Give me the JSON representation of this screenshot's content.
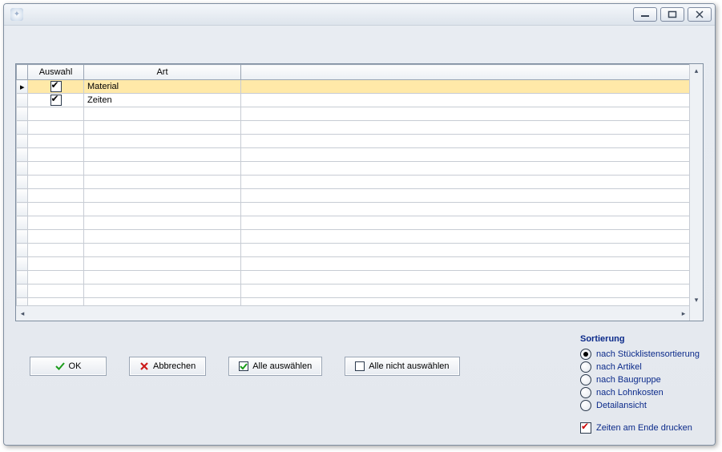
{
  "titlebar": {},
  "grid": {
    "columns": {
      "indicator": "",
      "auswahl": "Auswahl",
      "art": "Art"
    },
    "rows": [
      {
        "checked": true,
        "art": "Material",
        "selected": true,
        "current": true
      },
      {
        "checked": true,
        "art": "Zeiten",
        "selected": false,
        "current": false
      }
    ],
    "visible_empty_rows": 15
  },
  "buttons": {
    "ok": "OK",
    "cancel": "Abbrechen",
    "select_all": "Alle auswählen",
    "select_none": "Alle nicht auswählen"
  },
  "sort": {
    "title": "Sortierung",
    "options": [
      {
        "id": "stueckliste",
        "label": "nach Stücklistensortierung",
        "selected": true
      },
      {
        "id": "artikel",
        "label": "nach Artikel",
        "selected": false
      },
      {
        "id": "baugruppe",
        "label": "nach Baugruppe",
        "selected": false
      },
      {
        "id": "lohnkosten",
        "label": "nach Lohnkosten",
        "selected": false
      },
      {
        "id": "detail",
        "label": "Detailansicht",
        "selected": false
      }
    ]
  },
  "footer": {
    "print_times_at_end": {
      "label": "Zeiten am Ende drucken",
      "checked": true
    }
  }
}
